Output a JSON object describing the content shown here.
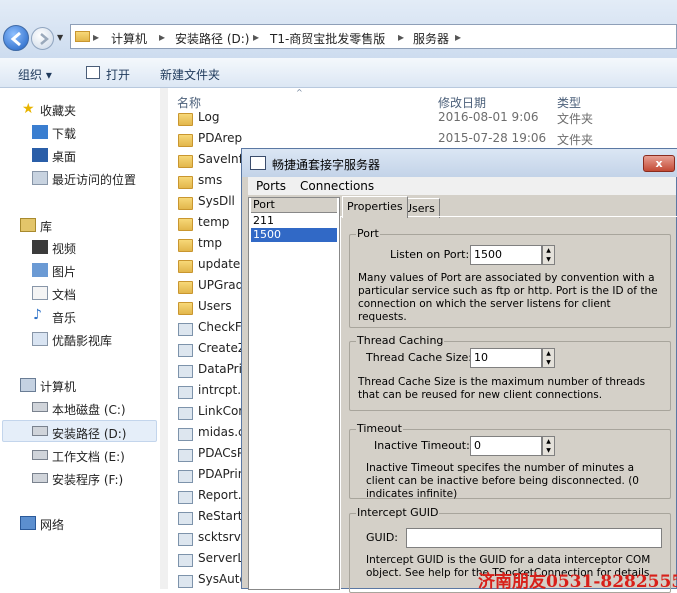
{
  "address": {
    "crumbs": [
      "计算机",
      "安装路径 (D:)",
      "T1-商贸宝批发零售版",
      "服务器"
    ],
    "sep": "▸"
  },
  "toolbar": {
    "organize": "组织 ▾",
    "open": "打开",
    "new_folder": "新建文件夹"
  },
  "nav": {
    "favorites": "收藏夹",
    "downloads": "下载",
    "desktop": "桌面",
    "recent": "最近访问的位置",
    "libraries": "库",
    "videos": "视频",
    "pictures": "图片",
    "documents": "文档",
    "music": "音乐",
    "youku": "优酷影视库",
    "computer": "计算机",
    "drive_c": "本地磁盘 (C:)",
    "drive_d": "安装路径 (D:)",
    "drive_e": "工作文档 (E:)",
    "drive_f": "安装程序 (F:)",
    "network": "网络"
  },
  "columns": {
    "name": "名称",
    "modified": "修改日期",
    "type": "类型"
  },
  "files": [
    {
      "name": "Log",
      "date": "2016-08-01 9:06",
      "type": "文件夹",
      "kind": "folder"
    },
    {
      "name": "PDArep",
      "date": "2015-07-28 19:06",
      "type": "文件夹",
      "kind": "folder"
    },
    {
      "name": "SaveInf",
      "kind": "folder"
    },
    {
      "name": "sms",
      "kind": "folder"
    },
    {
      "name": "SysDll",
      "kind": "folder"
    },
    {
      "name": "temp",
      "kind": "folder"
    },
    {
      "name": "tmp",
      "kind": "folder"
    },
    {
      "name": "update",
      "kind": "folder"
    },
    {
      "name": "UPGrad",
      "kind": "folder"
    },
    {
      "name": "Users",
      "kind": "folder"
    },
    {
      "name": "CheckF",
      "kind": "app"
    },
    {
      "name": "CreateZ",
      "kind": "app"
    },
    {
      "name": "DataPri",
      "kind": "app"
    },
    {
      "name": "intrcpt.",
      "kind": "app"
    },
    {
      "name": "LinkCor",
      "kind": "app"
    },
    {
      "name": "midas.c",
      "kind": "app"
    },
    {
      "name": "PDACsP",
      "kind": "app"
    },
    {
      "name": "PDAPrin",
      "kind": "app"
    },
    {
      "name": "Report.",
      "kind": "app"
    },
    {
      "name": "ReStart",
      "kind": "app"
    },
    {
      "name": "scktsrvr",
      "kind": "app"
    },
    {
      "name": "ServerL",
      "kind": "app"
    },
    {
      "name": "SysAuto",
      "kind": "app"
    }
  ],
  "dialog": {
    "title": "畅捷通套接字服务器",
    "close": "x",
    "menu": {
      "ports": "Ports",
      "connections": "Connections"
    },
    "port_list_header": "Port",
    "ports": [
      "211",
      "1500"
    ],
    "tabs": {
      "properties": "Properties",
      "users": "Users"
    },
    "port_group": {
      "title": "Port",
      "label": "Listen on Port:",
      "value": "1500",
      "desc": "Many values of Port are associated by convention with a particular service such as ftp or http. Port is the ID of the connection on which the server listens for client requests."
    },
    "thread_group": {
      "title": "Thread Caching",
      "label": "Thread Cache Size:",
      "value": "10",
      "desc": "Thread Cache Size is the maximum number of threads that can be reused for new client connections."
    },
    "timeout_group": {
      "title": "Timeout",
      "label": "Inactive Timeout:",
      "value": "0",
      "desc": "Inactive Timeout specifes the number of minutes a client can be inactive before being disconnected. (0 indicates infinite)"
    },
    "guid_group": {
      "title": "Intercept GUID",
      "label": "GUID:",
      "value": "",
      "desc": "Intercept GUID is the GUID for a data interceptor COM object. See help for the TSocketConnection for details."
    }
  },
  "watermark": "济南朋友0531-82825553",
  "colors": {
    "selection": "#3169c6",
    "watermark": "#d8201a"
  }
}
